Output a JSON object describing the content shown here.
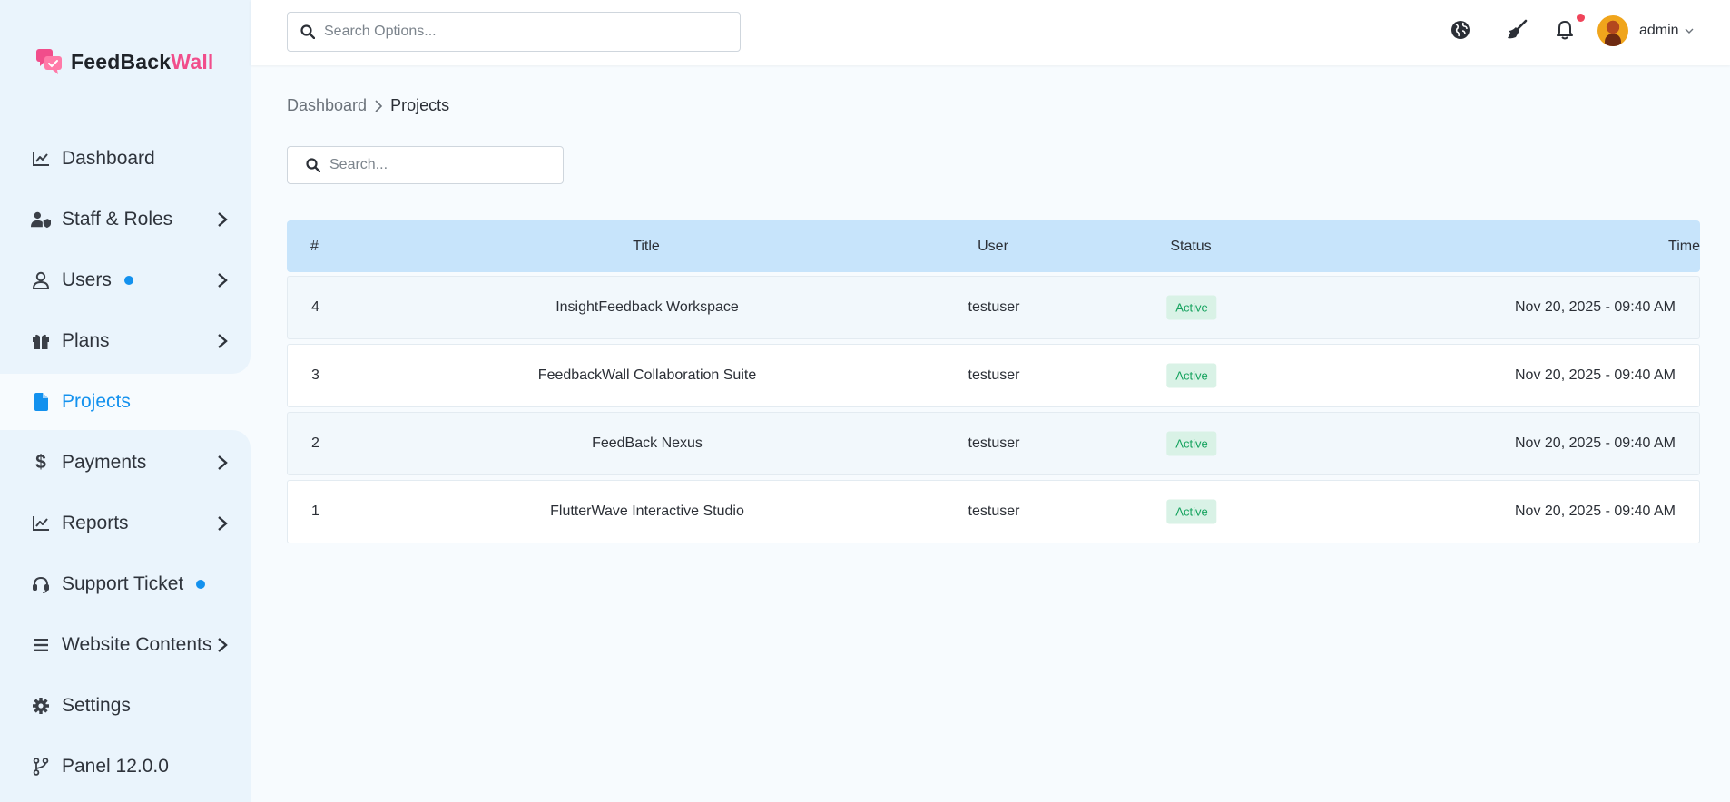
{
  "brand": {
    "name_part1": "FeedBack",
    "name_part2": "Wall",
    "accent_color": "#f14d8b"
  },
  "sidebar": {
    "items": [
      {
        "label": "Dashboard",
        "icon": "chart-line-icon",
        "has_chevron": false,
        "has_dot": false
      },
      {
        "label": "Staff & Roles",
        "icon": "user-shield-icon",
        "has_chevron": true,
        "has_dot": false
      },
      {
        "label": "Users",
        "icon": "user-icon",
        "has_chevron": true,
        "has_dot": true
      },
      {
        "label": "Plans",
        "icon": "gift-icon",
        "has_chevron": true,
        "has_dot": false
      },
      {
        "label": "Projects",
        "icon": "file-icon",
        "has_chevron": false,
        "has_dot": false,
        "active": true
      },
      {
        "label": "Payments",
        "icon": "dollar-icon",
        "has_chevron": true,
        "has_dot": false
      },
      {
        "label": "Reports",
        "icon": "chart-line-icon",
        "has_chevron": true,
        "has_dot": false
      },
      {
        "label": "Support Ticket",
        "icon": "headset-icon",
        "has_chevron": false,
        "has_dot": true
      },
      {
        "label": "Website Contents",
        "icon": "bars-icon",
        "has_chevron": true,
        "has_dot": false
      },
      {
        "label": "Settings",
        "icon": "gear-icon",
        "has_chevron": false,
        "has_dot": false
      },
      {
        "label": "Panel 12.0.0",
        "icon": "code-branch-icon",
        "has_chevron": false,
        "has_dot": false
      }
    ],
    "active_color": "#1391ee"
  },
  "topbar": {
    "search_placeholder": "Search Options...",
    "icons": [
      "globe-icon",
      "broom-icon",
      "bell-icon"
    ],
    "user_name": "admin"
  },
  "breadcrumb": {
    "home": "Dashboard",
    "current": "Projects"
  },
  "table": {
    "search_placeholder": "Search...",
    "columns": [
      "#",
      "Title",
      "User",
      "Status",
      "Time"
    ],
    "rows": [
      {
        "num": "4",
        "title": "InsightFeedback Workspace",
        "user": "testuser",
        "status": "Active",
        "time": "Nov 20, 2025 - 09:40 AM"
      },
      {
        "num": "3",
        "title": "FeedbackWall Collaboration Suite",
        "user": "testuser",
        "status": "Active",
        "time": "Nov 20, 2025 - 09:40 AM"
      },
      {
        "num": "2",
        "title": "FeedBack Nexus",
        "user": "testuser",
        "status": "Active",
        "time": "Nov 20, 2025 - 09:40 AM"
      },
      {
        "num": "1",
        "title": "FlutterWave Interactive Studio",
        "user": "testuser",
        "status": "Active",
        "time": "Nov 20, 2025 - 09:40 AM"
      }
    ],
    "header_color": "#c7e4fb",
    "status_color": "#16a35f"
  }
}
